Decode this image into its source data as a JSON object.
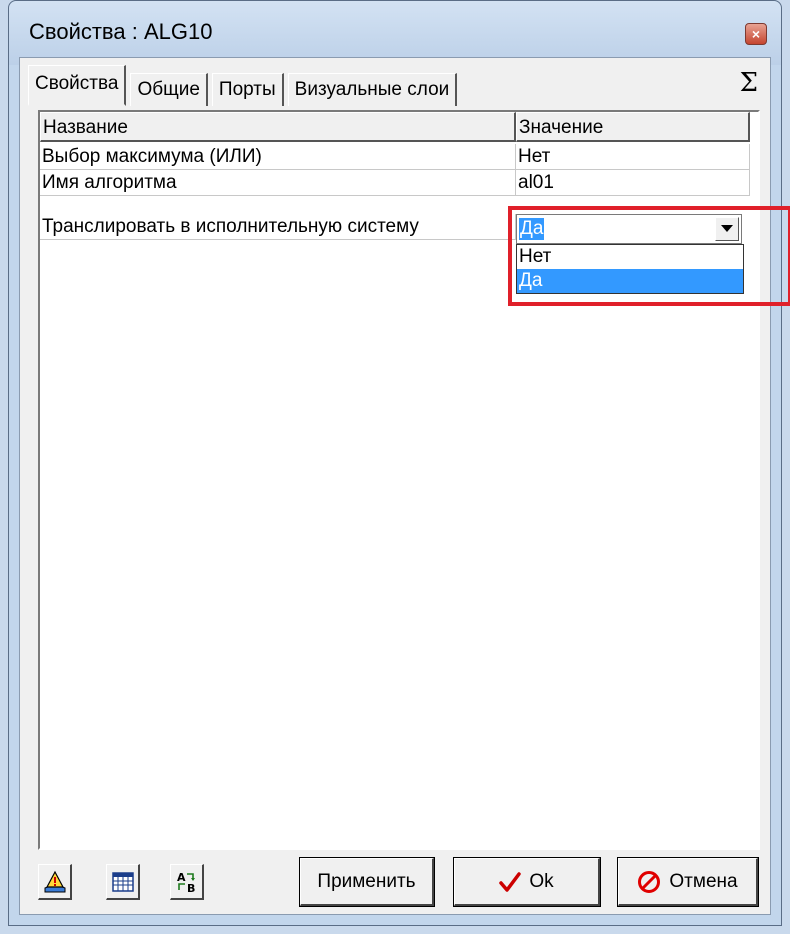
{
  "window": {
    "title": "Свойства :  ALG10",
    "close_glyph": "×"
  },
  "tabs": [
    {
      "label": "Свойства"
    },
    {
      "label": "Общие"
    },
    {
      "label": "Порты"
    },
    {
      "label": "Визуальные слои"
    }
  ],
  "sigma_glyph": "Σ",
  "table": {
    "headers": [
      "Название",
      "Значение"
    ],
    "rows": [
      {
        "name": "Выбор максимума (ИЛИ)",
        "value": "Нет"
      },
      {
        "name": "Имя алгоритма",
        "value": "al01"
      },
      {
        "name": "Транслировать в исполнительную систему",
        "value": "Да"
      }
    ]
  },
  "dropdown": {
    "selected": "Да",
    "options": [
      "Нет",
      "Да"
    ]
  },
  "buttons": {
    "apply": "Применить",
    "ok": "Ok",
    "cancel": "Отмена"
  },
  "colors": {
    "selection": "#3399ff",
    "highlight": "#e0202a",
    "ok_check": "#cc0000",
    "cancel_icon": "#e00000"
  },
  "icons": [
    "properties-icon",
    "table-icon",
    "sort-ab-icon",
    "checkmark-icon",
    "cancel-icon",
    "dropdown-arrow-icon"
  ]
}
